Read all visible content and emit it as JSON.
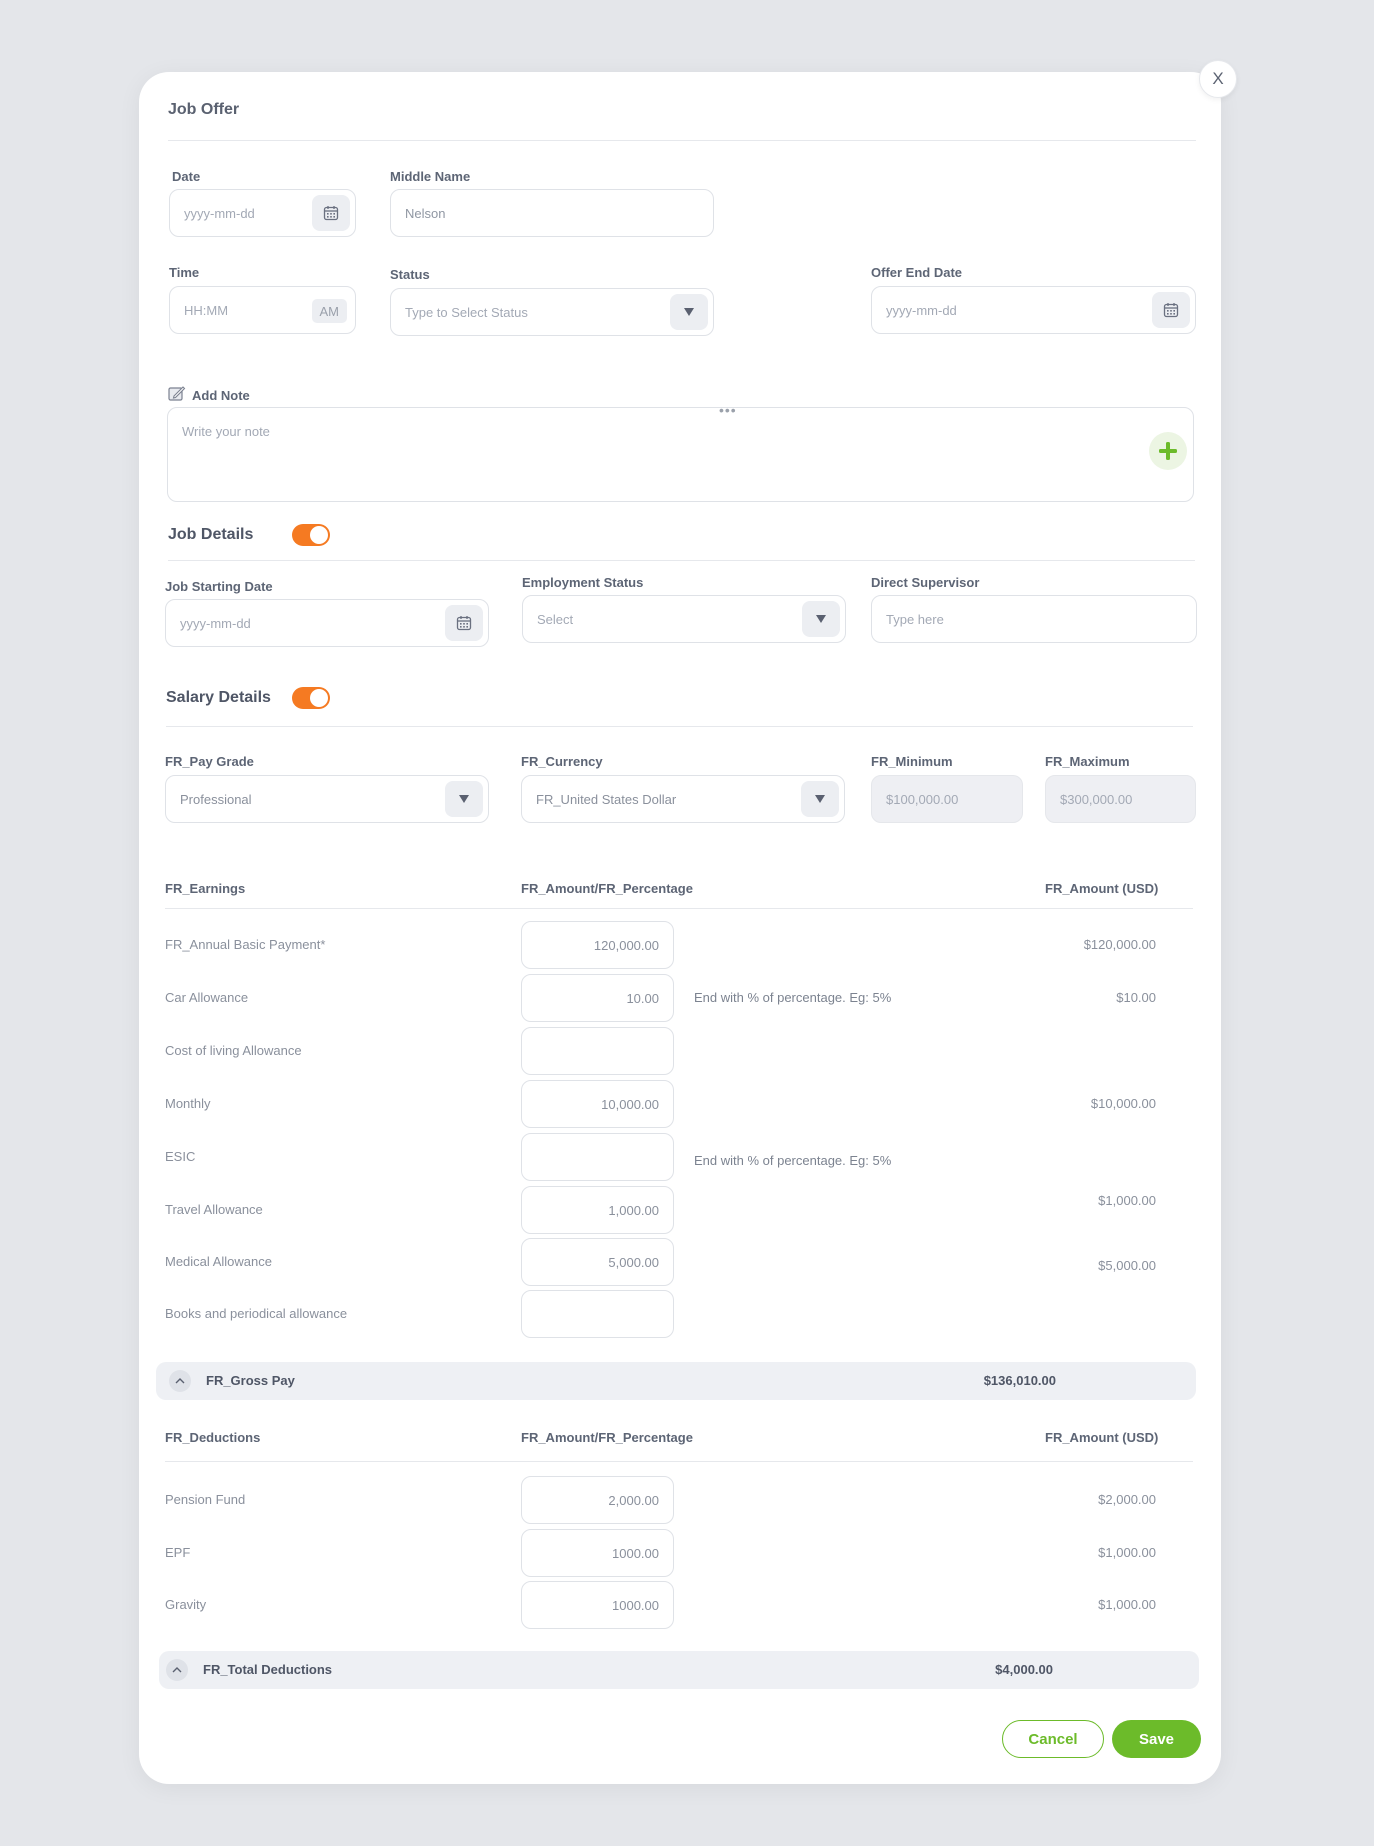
{
  "modal": {
    "title": "Job Offer",
    "close_label": "X"
  },
  "top_form": {
    "date": {
      "label": "Date",
      "placeholder": "yyyy-mm-dd"
    },
    "middle_name": {
      "label": "Middle Name",
      "value": "Nelson"
    },
    "time": {
      "label": "Time",
      "placeholder": "HH:MM",
      "ampm": "AM"
    },
    "status": {
      "label": "Status",
      "placeholder": "Type to Select  Status"
    },
    "offer_end_date": {
      "label": "Offer End Date",
      "placeholder": "yyyy-mm-dd"
    }
  },
  "note": {
    "label": "Add Note",
    "placeholder": "Write your note",
    "menu_dots": "•••"
  },
  "job_details": {
    "title": "Job Details",
    "toggle_on": true,
    "job_starting_date": {
      "label": "Job Starting Date",
      "placeholder": "yyyy-mm-dd"
    },
    "employment_status": {
      "label": "Employment Status",
      "placeholder": "Select"
    },
    "direct_supervisor": {
      "label": "Direct Supervisor",
      "placeholder": "Type here"
    }
  },
  "salary_details": {
    "title": "Salary Details",
    "toggle_on": true,
    "pay_grade": {
      "label": "FR_Pay Grade",
      "value": "Professional"
    },
    "currency": {
      "label": "FR_Currency",
      "value": "FR_United States Dollar"
    },
    "minimum": {
      "label": "FR_Minimum",
      "value": "$100,000.00"
    },
    "maximum": {
      "label": "FR_Maximum",
      "value": "$300,000.00"
    }
  },
  "earnings": {
    "headers": {
      "name": "FR_Earnings",
      "amount": "FR_Amount/FR_Percentage",
      "usd": "FR_Amount (USD)"
    },
    "rows": [
      {
        "name": "FR_Annual Basic Payment*",
        "amount": "120,000.00",
        "hint": "",
        "usd": "$120,000.00"
      },
      {
        "name": "Car Allowance",
        "amount": "10.00",
        "hint": "End with % of percentage. Eg: 5%",
        "usd": "$10.00"
      },
      {
        "name": "Cost of living Allowance",
        "amount": "",
        "hint": "",
        "usd": ""
      },
      {
        "name": "Monthly",
        "amount": "10,000.00",
        "hint": "",
        "usd": "$10,000.00"
      },
      {
        "name": "ESIC",
        "amount": "",
        "hint": "End with % of percentage. Eg: 5%",
        "usd": ""
      },
      {
        "name": "Travel Allowance",
        "amount": "1,000.00",
        "hint": "",
        "usd": "$1,000.00"
      },
      {
        "name": "Medical Allowance",
        "amount": "5,000.00",
        "hint": "",
        "usd": "$5,000.00"
      },
      {
        "name": "Books and periodical allowance",
        "amount": "",
        "hint": "",
        "usd": ""
      }
    ],
    "gross_label": "FR_Gross Pay",
    "gross_value": "$136,010.00"
  },
  "deductions": {
    "headers": {
      "name": "FR_Deductions",
      "amount": "FR_Amount/FR_Percentage",
      "usd": "FR_Amount (USD)"
    },
    "rows": [
      {
        "name": "Pension Fund",
        "amount": "2,000.00",
        "usd": "$2,000.00"
      },
      {
        "name": "EPF",
        "amount": "1000.00",
        "usd": "$1,000.00"
      },
      {
        "name": "Gravity",
        "amount": "1000.00",
        "usd": "$1,000.00"
      }
    ],
    "total_label": "FR_Total Deductions",
    "total_value": "$4,000.00"
  },
  "actions": {
    "cancel": "Cancel",
    "save": "Save"
  },
  "colors": {
    "accent_green": "#6cbb2a",
    "toggle_orange": "#f57a22",
    "background": "#e4e6ea"
  }
}
